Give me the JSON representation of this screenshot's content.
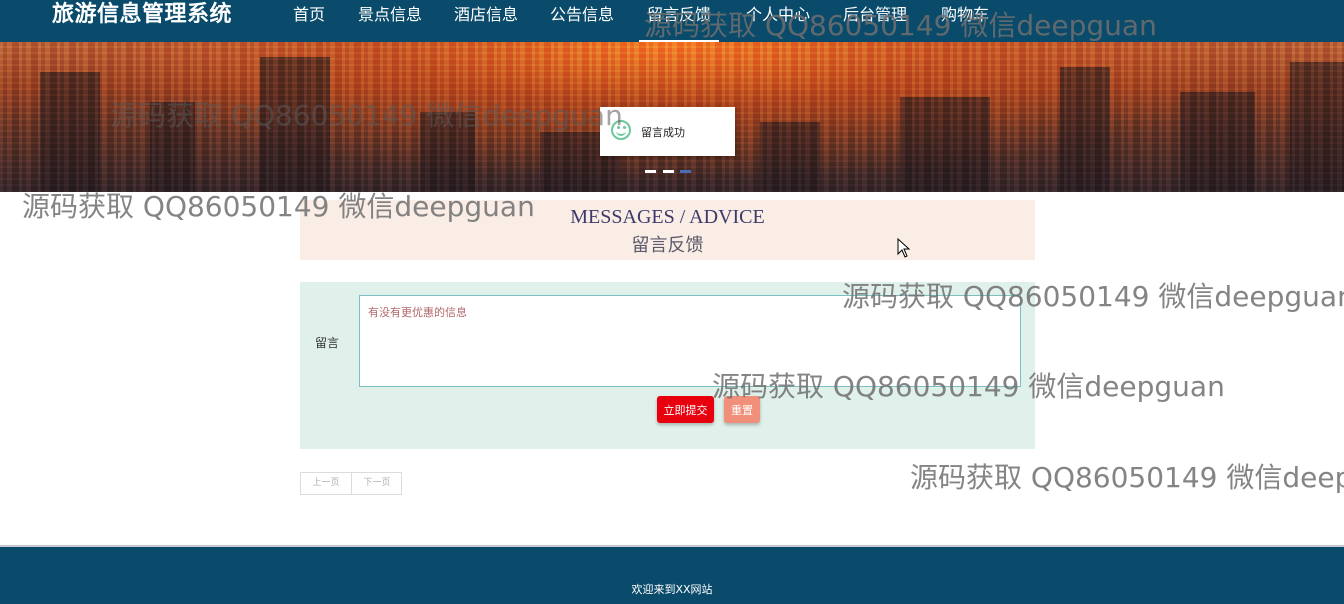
{
  "nav": {
    "brand": "旅游信息管理系统",
    "items": [
      {
        "label": "首页"
      },
      {
        "label": "景点信息"
      },
      {
        "label": "酒店信息"
      },
      {
        "label": "公告信息"
      },
      {
        "label": "留言反馈",
        "active": true
      },
      {
        "label": "个人中心"
      },
      {
        "label": "后台管理"
      },
      {
        "label": "购物车"
      }
    ]
  },
  "banner": {
    "toast_message": "留言成功",
    "slide_count": 3,
    "active_slide": 3
  },
  "section": {
    "title_en": "MESSAGES / ADVICE",
    "title_cn": "留言反馈"
  },
  "form": {
    "label": "留言",
    "message_value": "有没有更优惠的信息",
    "submit_label": "立即提交",
    "reset_label": "重置"
  },
  "pager": {
    "prev_label": "上一页",
    "next_label": "下一页"
  },
  "footer": {
    "text": "欢迎来到XX网站"
  },
  "watermark": {
    "text": "源码获取 QQ86050149 微信deepguan"
  },
  "colors": {
    "nav_bg": "#0a4b6b",
    "section_head_bg": "#f9ede6",
    "form_bg": "#e0f0ea",
    "submit_bg": "#e8000e",
    "reset_bg": "#f0907a"
  }
}
